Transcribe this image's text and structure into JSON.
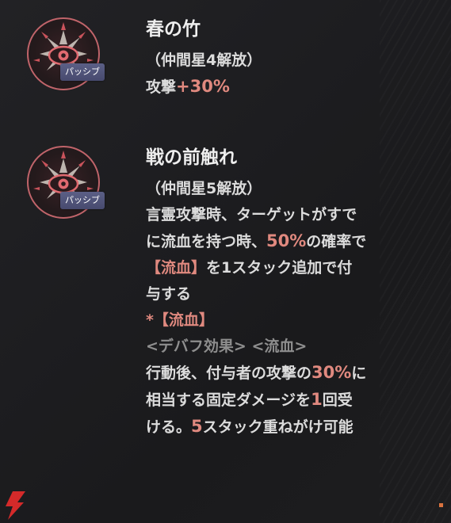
{
  "colors": {
    "background": "#1b1b1d",
    "highlight": "#e0897f",
    "muted": "#8e8e8e",
    "badge": "#5b5f86",
    "icon_ring": "#c0646a"
  },
  "skills": [
    {
      "icon": "eye-sigil-icon",
      "badge": "パッシブ",
      "title": "春の竹",
      "condition": "（仲間星4解放）",
      "effect": {
        "prefix": "攻撃",
        "value": "+30%"
      }
    },
    {
      "icon": "eye-sigil-icon",
      "badge": "パッシブ",
      "title": "戦の前触れ",
      "condition": "（仲間星5解放）",
      "desc": {
        "l1": "言霊攻撃時、ターゲットがすで",
        "l2a": "に流血を持つ時、",
        "l2b": "50%",
        "l2c": "の確率で",
        "l3a": "【流血】",
        "l3b": "を1スタック追加で付",
        "l4": "与する"
      },
      "note": {
        "header": "*【流血】",
        "tags": "<デバフ効果> <流血>",
        "l1a": "行動後、付与者の攻撃の",
        "l1b": "30%",
        "l1c": "に",
        "l2a": "相当する固定ダメージを",
        "l2b": "1",
        "l2c": "回受",
        "l3a": "ける。",
        "l3b": "5",
        "l3c": "スタック重ねがけ可能"
      }
    }
  ]
}
